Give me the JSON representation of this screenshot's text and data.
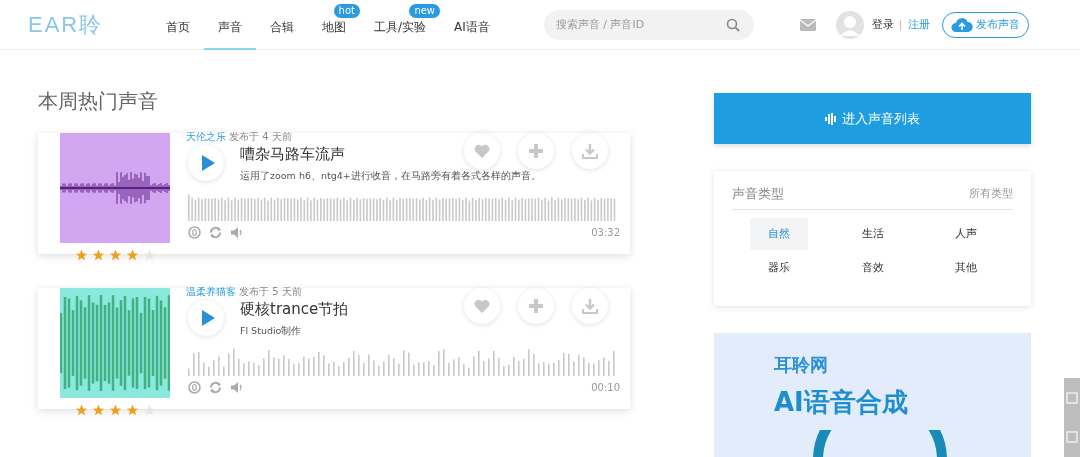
{
  "header": {
    "logo": "EAR聆",
    "nav": [
      {
        "label": "首页",
        "selected": false
      },
      {
        "label": "声音",
        "selected": true
      },
      {
        "label": "合辑",
        "selected": false
      },
      {
        "label": "地图",
        "selected": false,
        "badge": "hot"
      },
      {
        "label": "工具/实验",
        "selected": false,
        "badge": "new"
      },
      {
        "label": "AI语音",
        "selected": false
      }
    ],
    "search": {
      "placeholder": "搜索声音 / 声音ID"
    },
    "login": "登录",
    "separator": "|",
    "register": "注册",
    "publish": "发布声音"
  },
  "section_title": "本周热门声音",
  "sounds": [
    {
      "author": "天伦之乐",
      "posted": "发布于 4 天前",
      "title": "嘈杂马路车流声",
      "description": "运用了zoom h6、ntg4+进行收音，在马路旁有着各式各样的声音。",
      "duration": "03:32",
      "stars": 4,
      "color": "#d3a6f2",
      "kind": "dense"
    },
    {
      "author": "温柔养猫客",
      "posted": "发布于 5 天前",
      "title": "硬核trance节拍",
      "description": "Fl Studio制作",
      "duration": "00:10",
      "stars": 4,
      "color": "#8ae8dc",
      "kind": "varied"
    }
  ],
  "sidebar": {
    "list_button": "进入声音列表",
    "types_title": "声音类型",
    "all_types": "所有类型",
    "types": [
      {
        "label": "自然",
        "selected": true
      },
      {
        "label": "生活",
        "selected": false
      },
      {
        "label": "人声",
        "selected": false
      },
      {
        "label": "器乐",
        "selected": false
      },
      {
        "label": "音效",
        "selected": false
      },
      {
        "label": "其他",
        "selected": false
      }
    ],
    "banner": {
      "site": "耳聆网",
      "headline": "AI语音合成"
    }
  }
}
